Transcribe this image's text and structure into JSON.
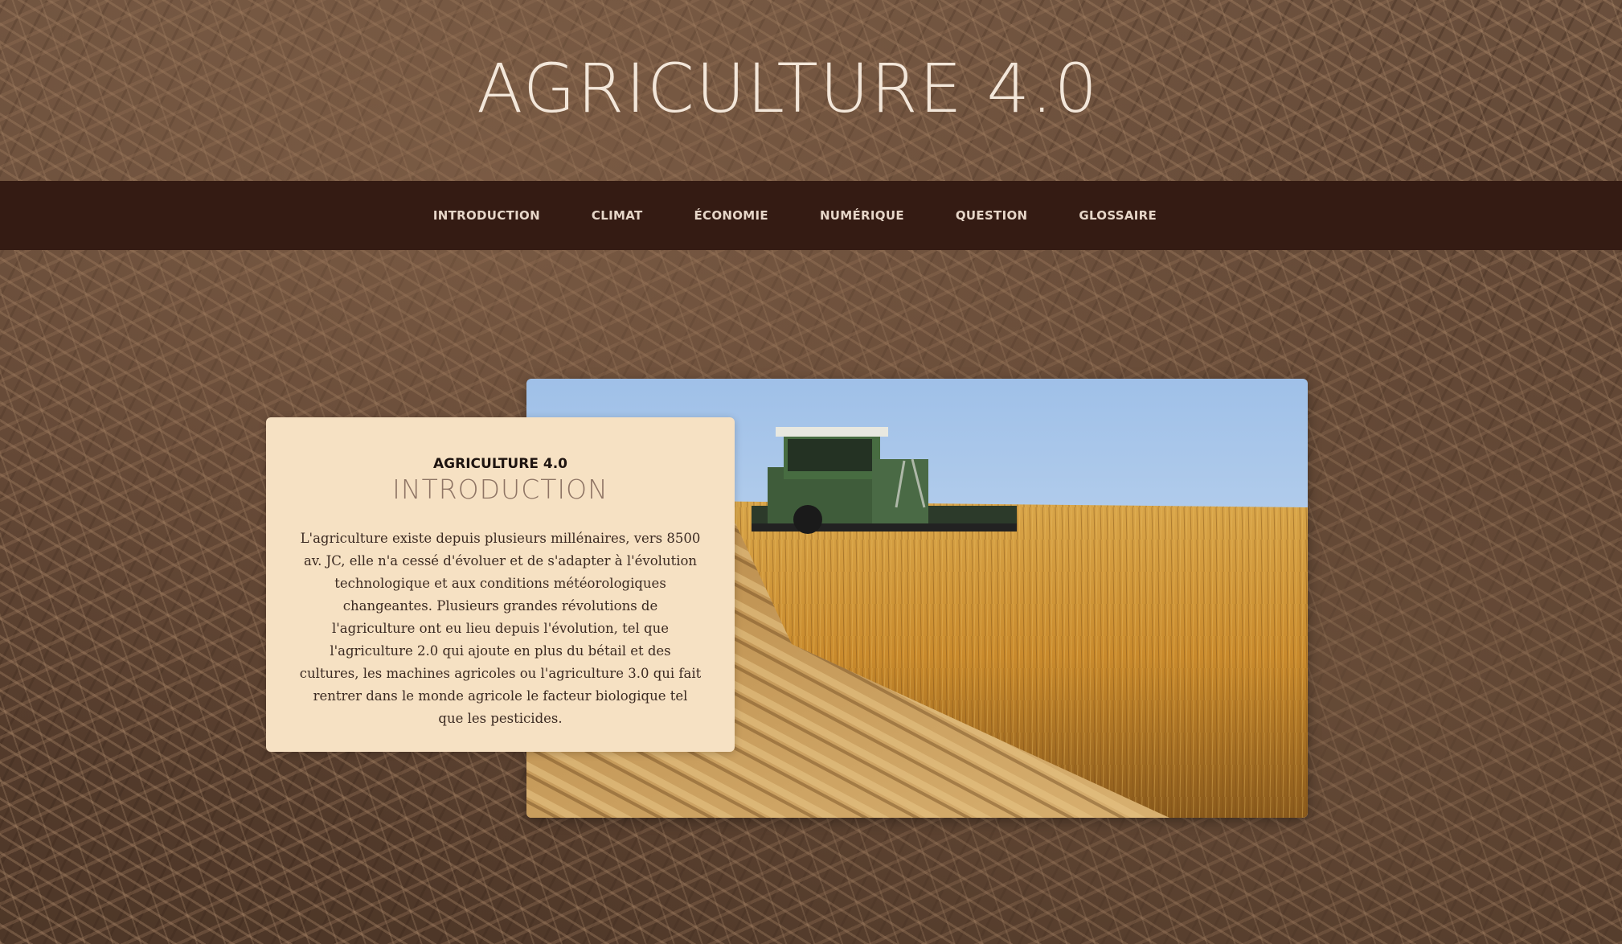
{
  "header": {
    "site_title": "AGRICULTURE 4.0"
  },
  "nav": {
    "items": [
      {
        "label": "INTRODUCTION"
      },
      {
        "label": "CLIMAT"
      },
      {
        "label": "ÉCONOMIE"
      },
      {
        "label": "NUMÉRIQUE"
      },
      {
        "label": "QUESTION"
      },
      {
        "label": "GLOSSAIRE"
      }
    ]
  },
  "card": {
    "kicker": "AGRICULTURE 4.0",
    "title": "INTRODUCTION",
    "text": "L'agriculture existe depuis plusieurs millénaires, vers 8500 av. JC, elle n'a cessé d'évoluer et de s'adapter à l'évolution technologique et aux conditions météorologiques changeantes. Plusieurs grandes révolutions de l'agriculture ont eu lieu depuis l'évolution, tel que l'agriculture 2.0 qui ajoute en plus du bétail et des cultures, les machines agricoles ou l'agriculture 3.0 qui fait rentrer dans le monde agricole le facteur biologique tel que les pesticides."
  },
  "colors": {
    "nav_background": "#341b13",
    "card_background": "#f6e1c3",
    "title_color": "#f3e7da"
  },
  "images": {
    "background": "straw-texture",
    "hero_photo": "combine-harvester-in-wheat-field"
  }
}
